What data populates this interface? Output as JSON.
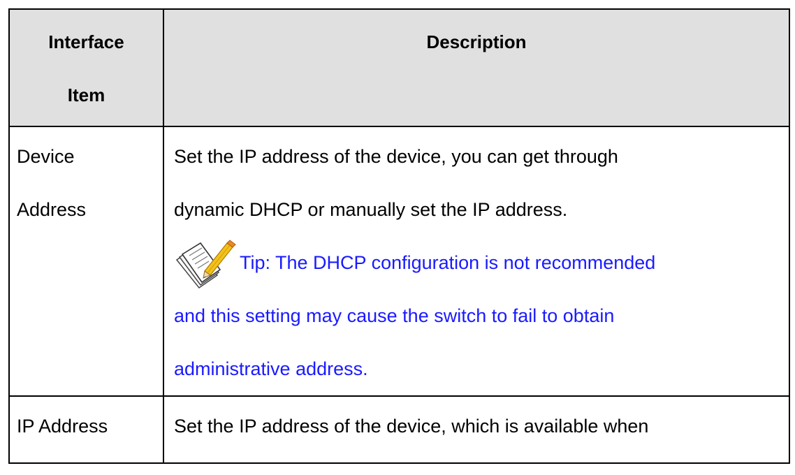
{
  "table": {
    "headers": {
      "item_line1": "Interface",
      "item_line2": "Item",
      "description": "Description"
    },
    "rows": [
      {
        "item_lines": [
          "Device",
          "Address"
        ],
        "description_lines": [
          "Set the IP address of the device, you can get through",
          "dynamic DHCP or manually set the IP address."
        ],
        "tip_lines": [
          "Tip: The DHCP configuration is not recommended",
          "and this setting may cause the switch to fail to obtain",
          "administrative address."
        ],
        "tip_icon": "note-pencil-icon"
      },
      {
        "item_lines": [
          "IP Address"
        ],
        "description_lines": [
          "Set the IP address of the device, which is available when"
        ]
      }
    ]
  },
  "colors": {
    "header_bg": "#e0e0e0",
    "tip_text": "#1a1aff",
    "border": "#000000"
  }
}
